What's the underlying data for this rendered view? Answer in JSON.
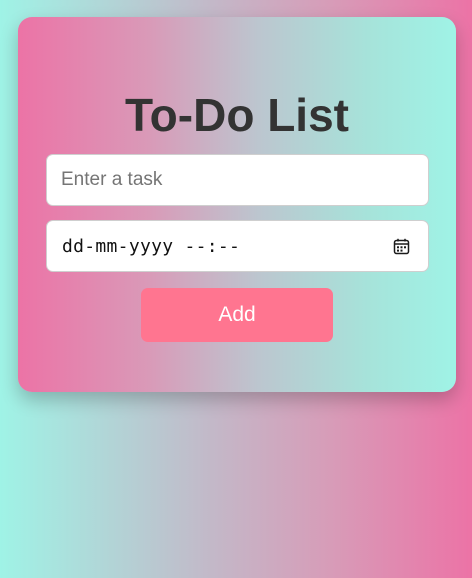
{
  "app": {
    "title": "To-Do List"
  },
  "form": {
    "task_placeholder": "Enter a task",
    "task_value": "",
    "datetime_display": "dd-mm-yyyy --:--",
    "add_label": "Add"
  },
  "icons": {
    "calendar": "calendar-icon"
  },
  "colors": {
    "add_button": "#ff7590",
    "title_text": "#333333",
    "gradient_pink": "#ec73a6",
    "gradient_mint": "#9ff3e6"
  }
}
